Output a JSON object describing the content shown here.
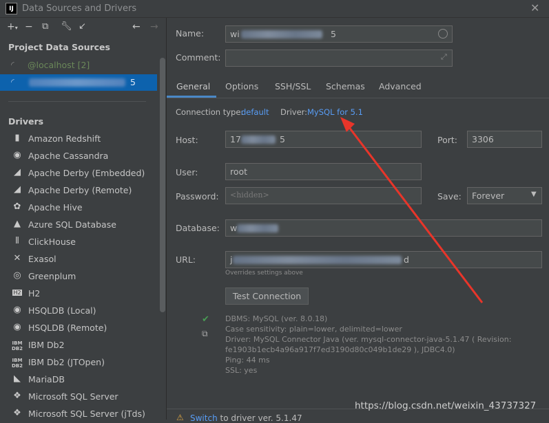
{
  "window": {
    "title": "Data Sources and Drivers",
    "app_icon": "IJ"
  },
  "toolbar": {
    "icons": [
      "add-icon",
      "remove-icon",
      "copy-icon",
      "wrench-icon",
      "import-icon",
      "back-icon",
      "forward-icon"
    ]
  },
  "left": {
    "project_header": "Project Data Sources",
    "data_sources": [
      {
        "label": "@localhost [2]",
        "color": "#6a8759"
      },
      {
        "label": "5",
        "selected": true
      }
    ],
    "drivers_header": "Drivers",
    "drivers": [
      "Amazon Redshift",
      "Apache Cassandra",
      "Apache Derby (Embedded)",
      "Apache Derby (Remote)",
      "Apache Hive",
      "Azure SQL Database",
      "ClickHouse",
      "Exasol",
      "Greenplum",
      "H2",
      "HSQLDB (Local)",
      "HSQLDB (Remote)",
      "IBM Db2",
      "IBM Db2 (JTOpen)",
      "MariaDB",
      "Microsoft SQL Server",
      "Microsoft SQL Server (jTds)"
    ]
  },
  "form": {
    "name_label": "Name:",
    "name_value_prefix": "wi",
    "name_value_suffix": "5",
    "comment_label": "Comment:",
    "tabs": [
      "General",
      "Options",
      "SSH/SSL",
      "Schemas",
      "Advanced"
    ],
    "active_tab": "General",
    "conn_type_label": "Connection type:",
    "conn_type_value": "default",
    "driver_label": "Driver:",
    "driver_value": "MySQL for 5.1",
    "host_label": "Host:",
    "host_prefix": "17",
    "host_suffix": "5",
    "port_label": "Port:",
    "port_value": "3306",
    "user_label": "User:",
    "user_value": "root",
    "password_label": "Password:",
    "password_placeholder": "<hidden>",
    "save_label": "Save:",
    "save_value": "Forever",
    "database_label": "Database:",
    "database_prefix": "w",
    "url_label": "URL:",
    "url_prefix": "j",
    "url_suffix": "d",
    "overrides_note": "Overrides settings above",
    "test_button": "Test Connection",
    "results": [
      "DBMS: MySQL (ver. 8.0.18)",
      "Case sensitivity: plain=lower, delimited=lower",
      "Driver: MySQL Connector Java (ver. mysql-connector-java-5.1.47 ( Revision:",
      "fe1903b1ecb4a96a917f7ed3190d80c049b1de29 ), JDBC4.0)",
      "Ping: 44 ms",
      "SSL: yes"
    ],
    "bottom_warning_link": "Switch",
    "bottom_warning_text": " to driver ver. 5.1.47"
  },
  "watermark": "https://blog.csdn.net/weixin_43737327",
  "colors": {
    "accent": "#589df6",
    "arrow": "#e8352a",
    "selected_bg": "#0d62ad"
  }
}
